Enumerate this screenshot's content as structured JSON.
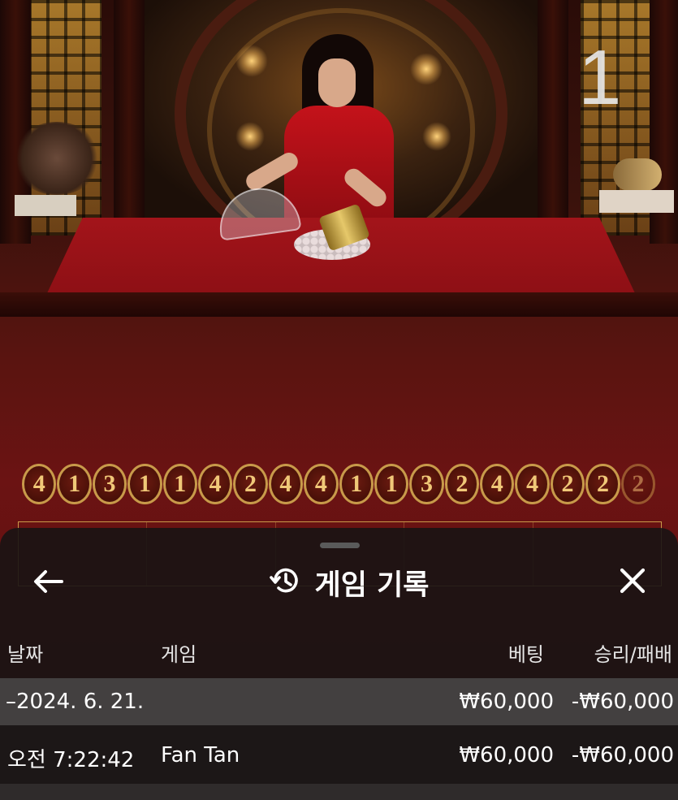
{
  "stream": {
    "round_number": "1",
    "result_history": [
      "4",
      "1",
      "3",
      "1",
      "1",
      "4",
      "2",
      "4",
      "4",
      "1",
      "1",
      "3",
      "2",
      "4",
      "4",
      "2",
      "2",
      "2"
    ]
  },
  "panel": {
    "title": "게임 기록",
    "back_icon": "arrow-left-icon",
    "history_icon": "history-icon",
    "close_icon": "close-icon",
    "columns": {
      "date": "날짜",
      "game": "게임",
      "bet": "베팅",
      "result": "승리/패배"
    },
    "groups": [
      {
        "date_label": "–2024. 6. 21.",
        "total_bet": "₩60,000",
        "total_result": "-₩60,000",
        "rows": [
          {
            "time": "오전 7:22:42",
            "game": "Fan Tan",
            "bet": "₩60,000",
            "result": "-₩60,000"
          }
        ]
      }
    ]
  },
  "colors": {
    "panel_bg": "#181414",
    "group_row_bg": "#464242",
    "accent_gold": "#c89a4a",
    "felt_red": "#a3141a"
  }
}
